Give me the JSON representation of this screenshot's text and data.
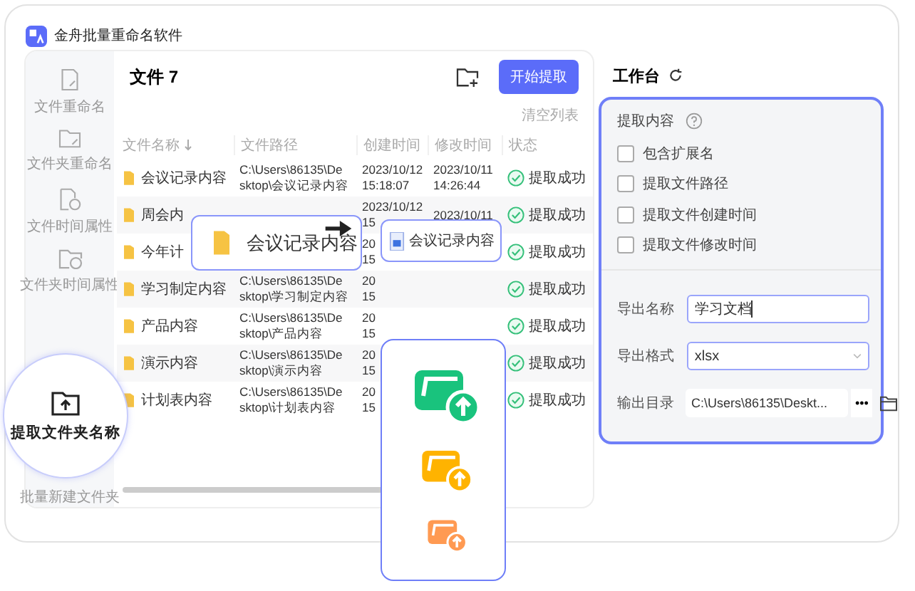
{
  "app": {
    "title": "金舟批量重命名软件"
  },
  "sidebar": {
    "items": [
      {
        "label": "文件重命名",
        "selected": false
      },
      {
        "label": "文件夹重命名",
        "selected": false
      },
      {
        "label": "文件时间属性",
        "selected": false
      },
      {
        "label": "文件夹时间属性",
        "selected": false
      },
      {
        "label": "提取文件夹名称",
        "selected": true
      },
      {
        "label": "批量新建文件夹",
        "selected": false
      }
    ]
  },
  "files": {
    "title": "文件 7",
    "start_button": "开始提取",
    "clear_link": "清空列表",
    "columns": [
      {
        "label": "文件名称",
        "sorted": true
      },
      {
        "label": "文件路径",
        "sorted": false
      },
      {
        "label": "创建时间",
        "sorted": false
      },
      {
        "label": "修改时间",
        "sorted": false
      },
      {
        "label": "状态",
        "sorted": false
      }
    ],
    "rows": [
      {
        "name": "会议记录内容",
        "path": [
          "C:\\Users\\86135\\De",
          "sktop\\会议记录内容"
        ],
        "created": [
          "2023/10/12",
          "15:18:07"
        ],
        "modified": [
          "2023/10/11",
          "14:26:44"
        ],
        "status": "提取成功"
      },
      {
        "name": "周会内",
        "path": [],
        "created": [
          "2023/10/12",
          "15"
        ],
        "modified": [
          "2023/10/11"
        ],
        "status": "提取成功"
      },
      {
        "name": "今年计",
        "path": [],
        "created": [
          "20",
          "15"
        ],
        "modified": [],
        "status": "提取成功"
      },
      {
        "name": "学习制定内容",
        "path": [
          "C:\\Users\\86135\\De",
          "sktop\\学习制定内容"
        ],
        "created": [
          "20",
          "15"
        ],
        "modified": [],
        "status": "提取成功"
      },
      {
        "name": "产品内容",
        "path": [
          "C:\\Users\\86135\\De",
          "sktop\\产品内容"
        ],
        "created": [
          "20",
          "15"
        ],
        "modified": [],
        "status": "提取成功"
      },
      {
        "name": "演示内容",
        "path": [
          "C:\\Users\\86135\\De",
          "sktop\\演示内容"
        ],
        "created": [
          "20",
          "15"
        ],
        "modified": [],
        "status": "提取成功"
      },
      {
        "name": "计划表内容",
        "path": [
          "C:\\Users\\86135\\De",
          "sktop\\计划表内容"
        ],
        "created": [
          "20",
          "15"
        ],
        "modified": [],
        "status": "提取成功"
      }
    ]
  },
  "callouts": {
    "source": "会议记录内容",
    "target": "会议记录内容"
  },
  "workspace": {
    "title": "工作台",
    "section": "提取内容",
    "options": [
      {
        "label": "包含扩展名",
        "checked": false
      },
      {
        "label": "提取文件路径",
        "checked": false
      },
      {
        "label": "提取文件创建时间",
        "checked": false
      },
      {
        "label": "提取文件修改时间",
        "checked": false
      }
    ],
    "fields": [
      {
        "kind": "text",
        "label": "导出名称",
        "value": "学习文档"
      },
      {
        "kind": "select",
        "label": "导出格式",
        "value": "xlsx"
      },
      {
        "kind": "path",
        "label": "输出目录",
        "value": "C:\\Users\\86135\\Deskt...",
        "button": "•••"
      }
    ]
  }
}
